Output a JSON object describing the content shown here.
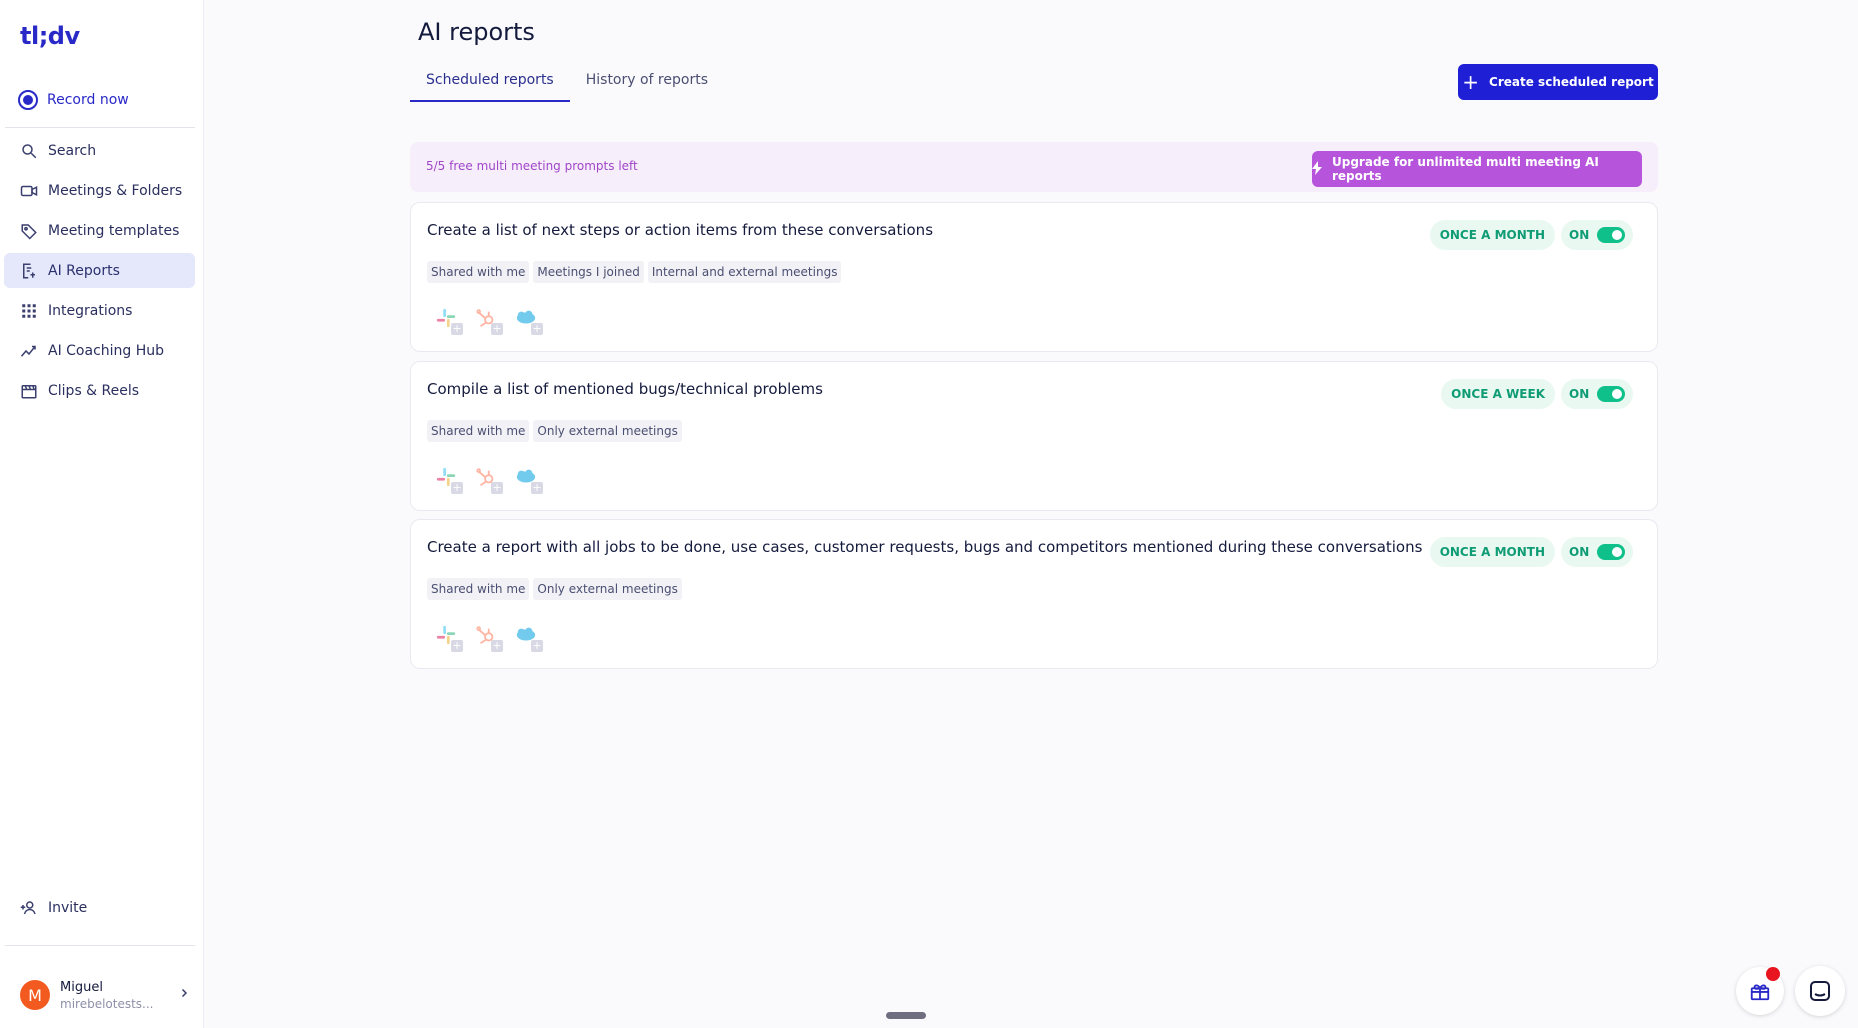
{
  "sidebar": {
    "logo": "tl;dv",
    "record_now": "Record now",
    "items": [
      {
        "label": "Search",
        "icon": "search-icon"
      },
      {
        "label": "Meetings & Folders",
        "icon": "video-icon"
      },
      {
        "label": "Meeting templates",
        "icon": "tag-icon"
      },
      {
        "label": "AI Reports",
        "icon": "report-icon",
        "active": true
      },
      {
        "label": "Integrations",
        "icon": "grid-icon"
      },
      {
        "label": "AI Coaching Hub",
        "icon": "trend-icon"
      },
      {
        "label": "Clips & Reels",
        "icon": "clapper-icon"
      }
    ],
    "invite": "Invite",
    "user": {
      "initial": "M",
      "name": "Miguel",
      "email": "mirebelotests..."
    }
  },
  "header": {
    "title": "AI reports",
    "tabs": [
      {
        "label": "Scheduled reports",
        "active": true
      },
      {
        "label": "History of reports"
      }
    ],
    "create_button": "Create scheduled report"
  },
  "promo": {
    "text": "5/5 free multi meeting prompts left",
    "upgrade_button": "Upgrade for unlimited multi meeting AI reports"
  },
  "reports": [
    {
      "title": "Create a list of next steps or action items from these conversations",
      "chips": [
        "Shared with me",
        "Meetings I joined",
        "Internal and external meetings"
      ],
      "frequency": "ONCE A MONTH",
      "status": "ON"
    },
    {
      "title": "Compile a list of mentioned bugs/technical problems",
      "chips": [
        "Shared with me",
        "Only external meetings"
      ],
      "frequency": "ONCE A WEEK",
      "status": "ON"
    },
    {
      "title": "Create a report with all jobs to be done, use cases, customer requests, bugs and competitors mentioned during these conversations",
      "chips": [
        "Shared with me",
        "Only external meetings"
      ],
      "frequency": "ONCE A MONTH",
      "status": "ON"
    }
  ],
  "colors": {
    "accent": "#1f1fd6",
    "upgrade": "#b655dc",
    "on_green": "#10c08a",
    "avatar": "#f25a1f"
  }
}
